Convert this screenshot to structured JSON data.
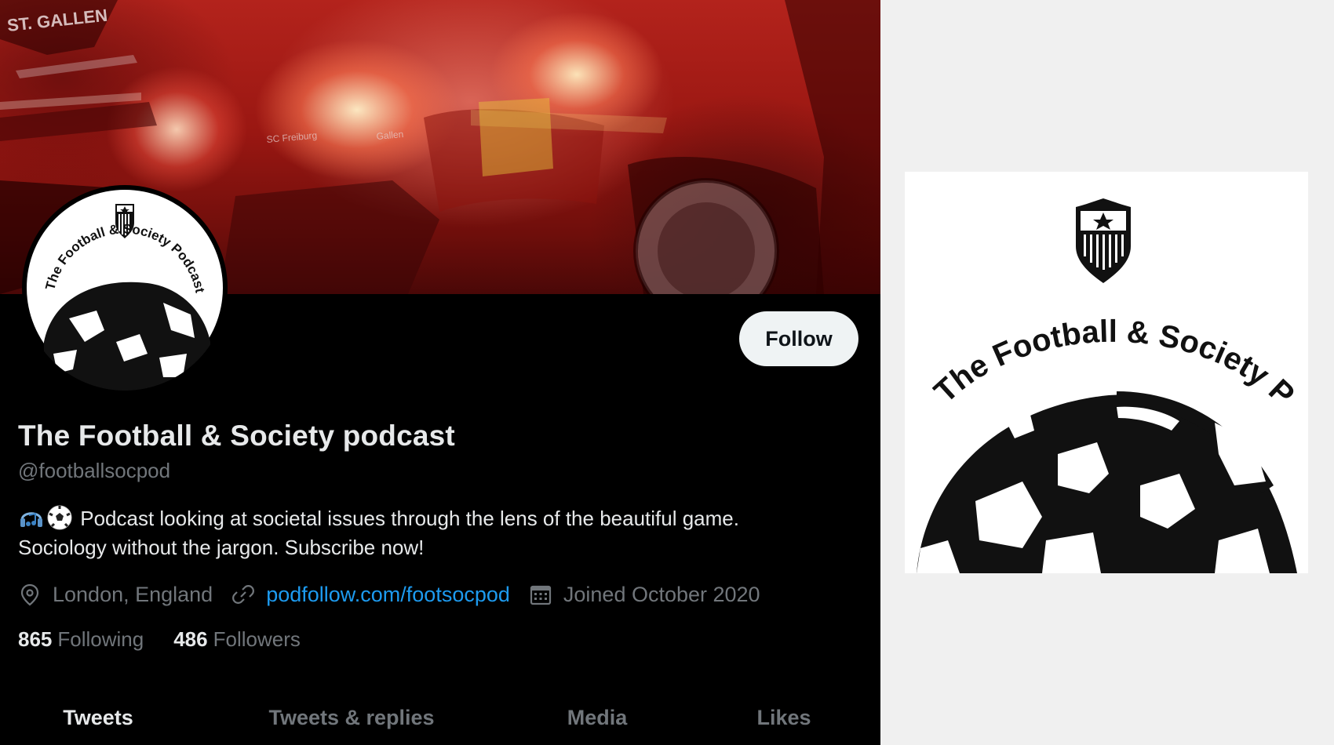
{
  "profile": {
    "display_name": "The Football & Society podcast",
    "handle": "@footballsocpod",
    "bio_line1": "Podcast looking at societal issues through the lens of the beautiful game.",
    "bio_line2": "Sociology without the jargon. Subscribe now!",
    "bio_emojis": [
      "headphones-music-icon",
      "soccer-ball-icon"
    ],
    "location": "London, England",
    "website": "podfollow.com/footsocpod",
    "joined": "Joined October 2020",
    "following_count": "865",
    "following_label": "Following",
    "followers_count": "486",
    "followers_label": "Followers",
    "follow_button": "Follow"
  },
  "banner": {
    "visible_text": [
      "ST. GALLEN",
      "SC Freiburg",
      "Gallen"
    ]
  },
  "avatar": {
    "logo_text": "The Football & Society Podcast"
  },
  "tabs": [
    {
      "label": "Tweets",
      "active": true
    },
    {
      "label": "Tweets & replies",
      "active": false
    },
    {
      "label": "Media",
      "active": false
    },
    {
      "label": "Likes",
      "active": false
    }
  ],
  "logo_card": {
    "logo_text": "The Football & Society Podcast"
  },
  "colors": {
    "background": "#000000",
    "text_primary": "#e7e9ea",
    "text_secondary": "#71767b",
    "link": "#1d9bf0",
    "button_bg": "#eff3f4",
    "banner_red": "#b3231c"
  }
}
